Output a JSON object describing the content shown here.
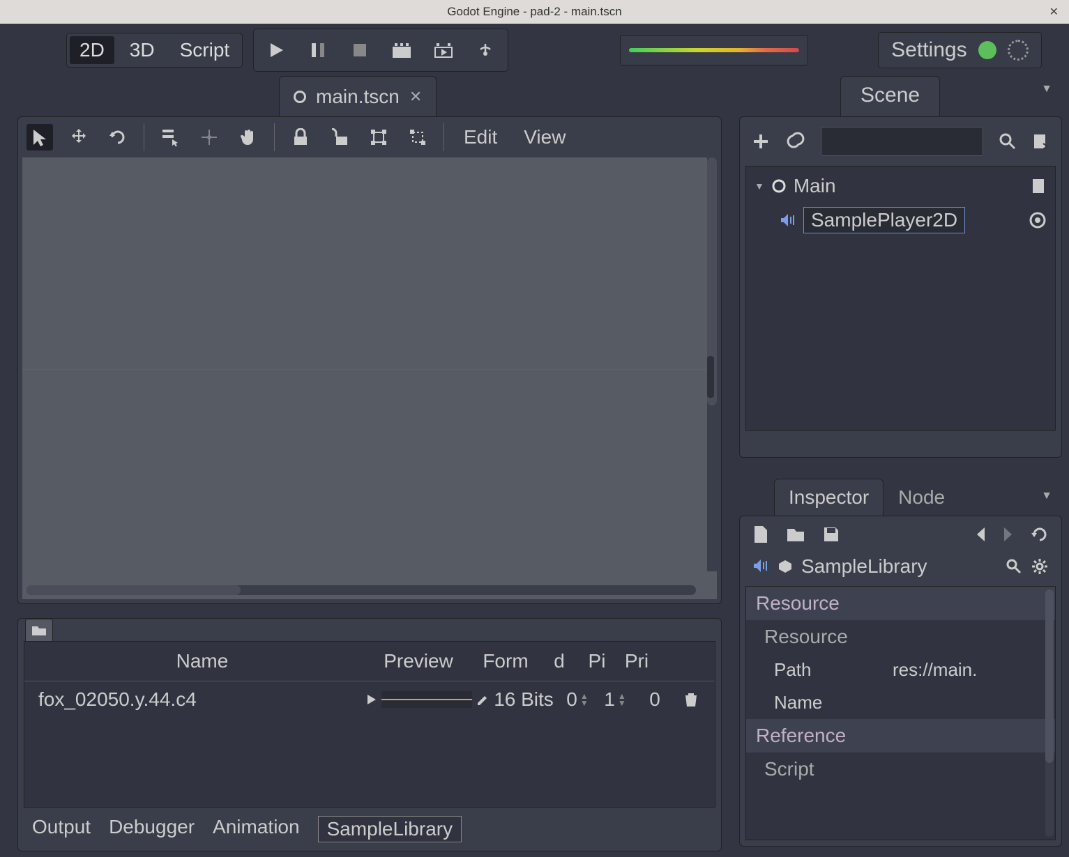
{
  "window": {
    "title": "Godot Engine - pad-2 - main.tscn"
  },
  "modes": {
    "m2d": "2D",
    "m3d": "3D",
    "script": "Script"
  },
  "settings_label": "Settings",
  "scene_tab": "main.tscn",
  "viewport_menus": {
    "edit": "Edit",
    "view": "View"
  },
  "scene_dock_label": "Scene",
  "tree": {
    "root": "Main",
    "child": "SamplePlayer2D"
  },
  "inspector_tabs": {
    "inspector": "Inspector",
    "node": "Node"
  },
  "inspector": {
    "object": "SampleLibrary",
    "cat_resource": "Resource",
    "sub_resource": "Resource",
    "prop_path": "Path",
    "prop_path_val": "res://main.",
    "prop_name": "Name",
    "cat_reference": "Reference",
    "sub_script": "Script"
  },
  "sample_table": {
    "headers": {
      "name": "Name",
      "preview": "Preview",
      "form": "Form",
      "d": "d",
      "pi": "Pi",
      "pri": "Pri"
    },
    "row": {
      "name": "fox_02050.y.44.c4",
      "format": "16 Bits",
      "d": "0",
      "pi": "1",
      "pri": "0"
    }
  },
  "bottom_tabs": {
    "output": "Output",
    "debugger": "Debugger",
    "animation": "Animation",
    "sample": "SampleLibrary"
  }
}
